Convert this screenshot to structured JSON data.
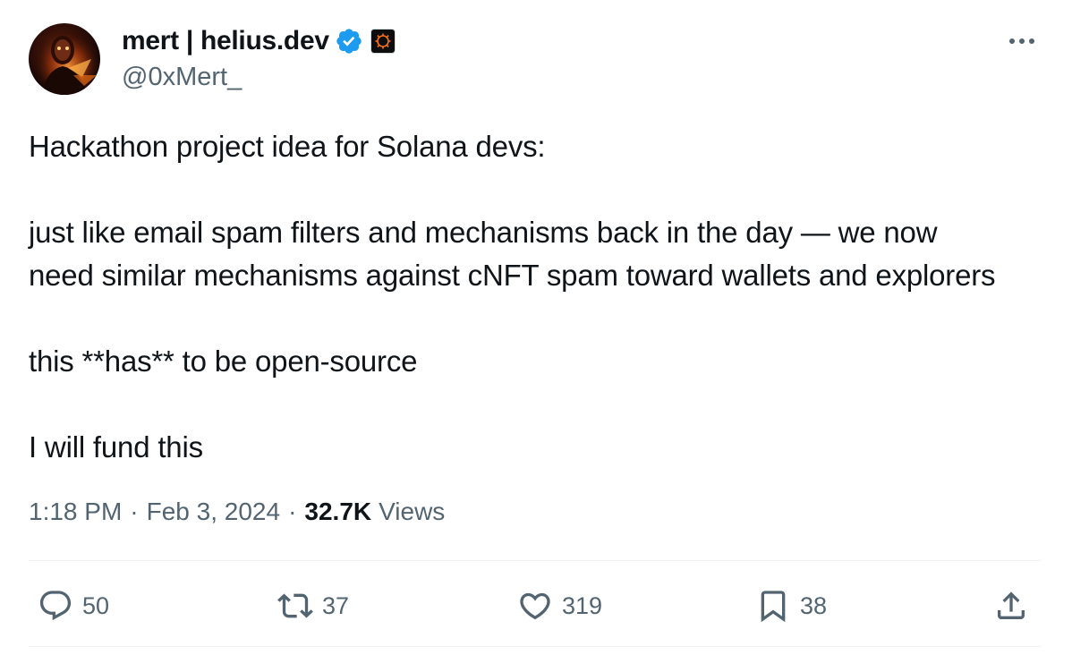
{
  "author": {
    "display_name": "mert | helius.dev",
    "handle": "@0xMert_",
    "verified": true
  },
  "tweet": {
    "lines": [
      "Hackathon project idea for Solana devs:",
      "",
      "just like email spam filters and mechanisms back in the day — we now",
      "need similar mechanisms against cNFT spam toward wallets and explorers",
      "",
      "this **has** to be open-source",
      "",
      "I will fund this"
    ]
  },
  "meta": {
    "time": "1:18 PM",
    "separator": "·",
    "date": "Feb 3, 2024",
    "views_count": "32.7K",
    "views_label": "Views"
  },
  "actions": {
    "reply": {
      "icon": "reply-icon",
      "count": "50"
    },
    "retweet": {
      "icon": "retweet-icon",
      "count": "37"
    },
    "like": {
      "icon": "heart-icon",
      "count": "319"
    },
    "bookmark": {
      "icon": "bookmark-icon",
      "count": "38"
    },
    "share": {
      "icon": "share-icon"
    }
  },
  "colors": {
    "text_primary": "#0f1419",
    "text_secondary": "#536471",
    "verified_blue": "#1d9bf0",
    "divider": "#eff3f4"
  }
}
